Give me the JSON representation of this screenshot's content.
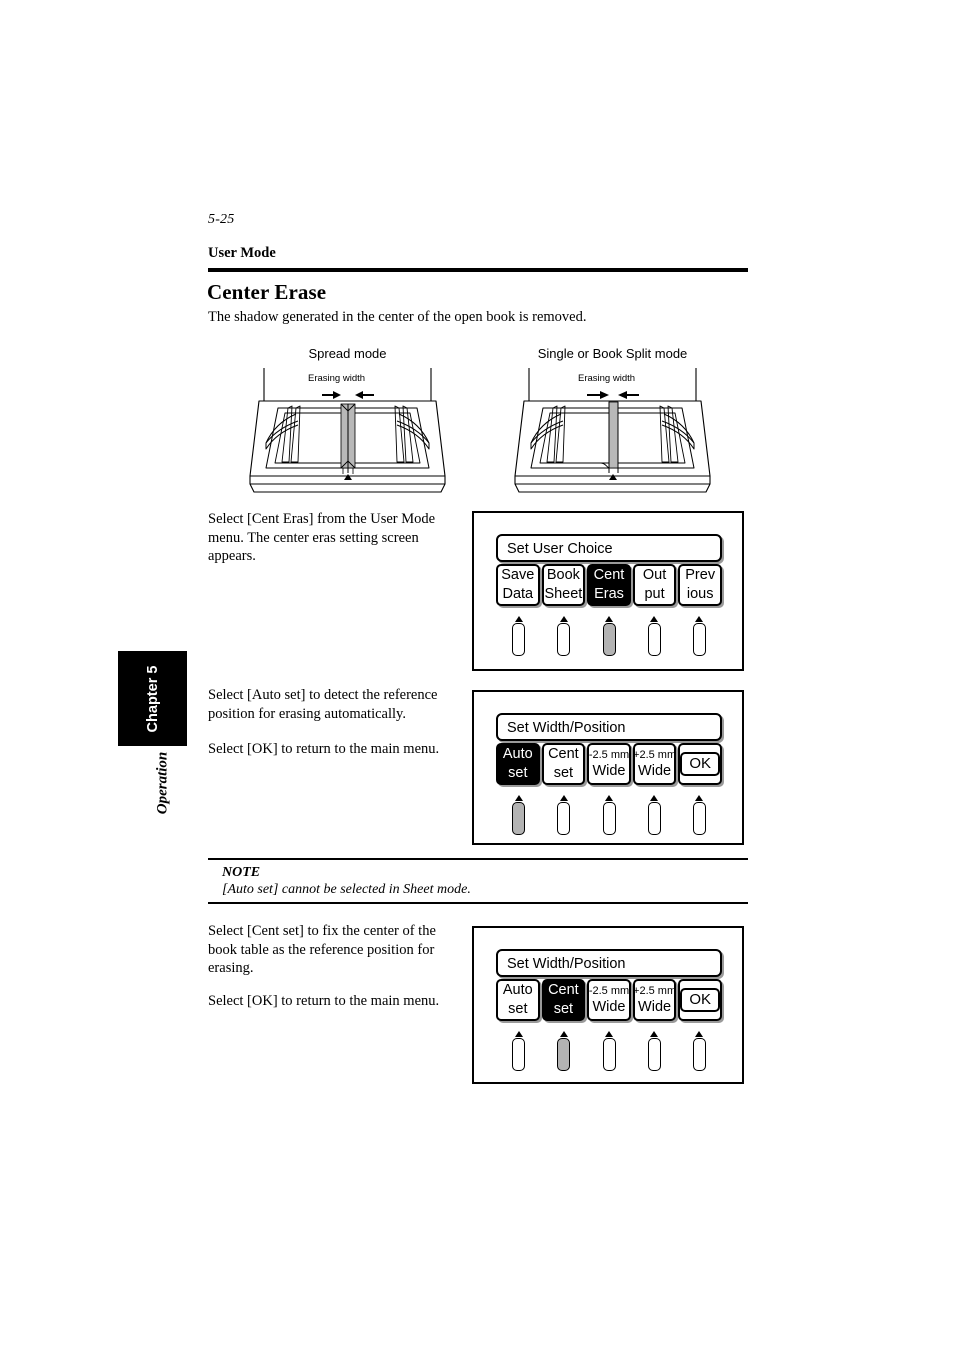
{
  "page": {
    "folio": "5-25",
    "running_head": "User Mode",
    "section_title": "Center Erase",
    "intro": "The shadow generated in the center of the open book is removed."
  },
  "chapter_tab": {
    "chapter_label": "Chapter 5",
    "section_label": "Operation"
  },
  "diagrams": {
    "left": {
      "caption": "Spread mode",
      "erase_label": "Erasing width"
    },
    "right": {
      "caption": "Single or Book Split mode",
      "erase_label": "Erasing width"
    }
  },
  "paragraphs": {
    "cent_eras": "Select [Cent Eras] from the User Mode menu. The center eras setting screen appears.",
    "auto_set": "Select [Auto set] to detect the reference position for erasing automatically.",
    "auto_set_ok": "Select [OK] to return to the main menu.",
    "cent_set": "Select [Cent set] to fix the center of the book table as the reference position for erasing.",
    "cent_set_ok": "Select [OK] to return to the main menu."
  },
  "note": {
    "label": "NOTE",
    "text": "[Auto set] cannot be selected in Sheet mode."
  },
  "panels": [
    {
      "id": "user-choice",
      "title": "Set User Choice",
      "buttons": [
        {
          "line1": "Save",
          "line2": "Data",
          "selected": false,
          "small_first_line": false,
          "boxed": false
        },
        {
          "line1": "Book",
          "line2": "Sheet",
          "selected": false,
          "small_first_line": false,
          "boxed": false
        },
        {
          "line1": "Cent",
          "line2": "Eras",
          "selected": true,
          "small_first_line": false,
          "boxed": false
        },
        {
          "line1": "Out",
          "line2": "put",
          "selected": false,
          "small_first_line": false,
          "boxed": false
        },
        {
          "line1": "Prev",
          "line2": "ious",
          "selected": false,
          "small_first_line": false,
          "boxed": false
        }
      ],
      "active_key_index": 2
    },
    {
      "id": "width-position-auto",
      "title": "Set Width/Position",
      "buttons": [
        {
          "line1": "Auto",
          "line2": "set",
          "selected": true,
          "small_first_line": false,
          "boxed": false
        },
        {
          "line1": "Cent",
          "line2": "set",
          "selected": false,
          "small_first_line": false,
          "boxed": false
        },
        {
          "line1": "-2.5 mm",
          "line2": "Wide",
          "selected": false,
          "small_first_line": true,
          "boxed": false
        },
        {
          "line1": "+2.5 mm",
          "line2": "Wide",
          "selected": false,
          "small_first_line": true,
          "boxed": false
        },
        {
          "line1": "",
          "line2": "OK",
          "selected": false,
          "small_first_line": false,
          "boxed": true
        }
      ],
      "active_key_index": 0
    },
    {
      "id": "width-position-cent",
      "title": "Set Width/Position",
      "buttons": [
        {
          "line1": "Auto",
          "line2": "set",
          "selected": false,
          "small_first_line": false,
          "boxed": false
        },
        {
          "line1": "Cent",
          "line2": "set",
          "selected": true,
          "small_first_line": false,
          "boxed": false
        },
        {
          "line1": "-2.5 mm",
          "line2": "Wide",
          "selected": false,
          "small_first_line": true,
          "boxed": false
        },
        {
          "line1": "+2.5 mm",
          "line2": "Wide",
          "selected": false,
          "small_first_line": true,
          "boxed": false
        },
        {
          "line1": "",
          "line2": "OK",
          "selected": false,
          "small_first_line": false,
          "boxed": true
        }
      ],
      "active_key_index": 1
    }
  ],
  "colors": {
    "ink": "#000000",
    "paper": "#ffffff",
    "key_active": "#b3b3b3",
    "shadow": "#9a9a9a",
    "erase_band": "#b8b8b8"
  }
}
